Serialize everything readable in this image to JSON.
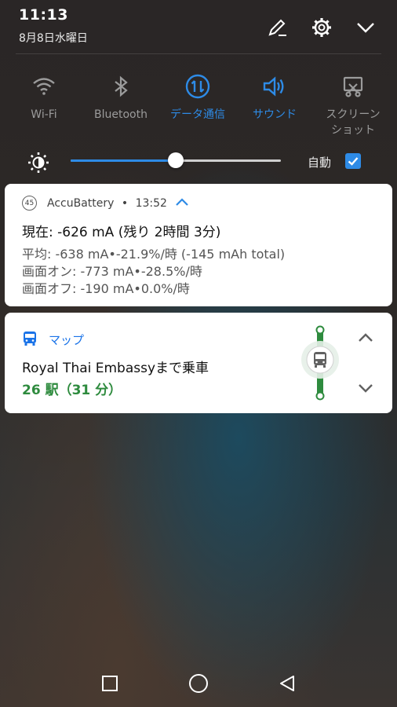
{
  "status": {
    "time": "11:13",
    "date": "8月8日水曜日"
  },
  "header_icons": [
    "edit-icon",
    "settings-icon",
    "collapse-chevron-icon"
  ],
  "toggles": [
    {
      "label": "Wi-Fi",
      "state": "off",
      "icon": "wifi-icon"
    },
    {
      "label": "Bluetooth",
      "state": "off",
      "icon": "bluetooth-icon"
    },
    {
      "label": "データ通信",
      "state": "on",
      "icon": "mobile-data-icon"
    },
    {
      "label": "サウンド",
      "state": "on",
      "icon": "sound-icon"
    },
    {
      "label": "スクリーン\nショット",
      "label_line1": "スクリーン",
      "label_line2": "ショット",
      "state": "off",
      "icon": "screenshot-icon"
    }
  ],
  "brightness": {
    "level": 0.5,
    "auto_label": "自動",
    "auto_checked": true
  },
  "notifications": {
    "battery": {
      "badge": "45",
      "app": "AccuBattery",
      "separator": "•",
      "time": "13:52",
      "title": "現在: -626 mA (残り 2時間 3分)",
      "lines": [
        "平均: -638 mA•-21.9%/時 (-145 mAh total)",
        "画面オン: -773 mA•-28.5%/時",
        "画面オフ: -190 mA•0.0%/時"
      ]
    },
    "maps": {
      "app": "マップ",
      "title": "Royal Thai Embassyまで乗車",
      "subtitle": "26 駅（31 分）"
    }
  },
  "colors": {
    "accent": "#2e8be6",
    "transit_green": "#2e8b3e"
  },
  "nav": [
    "recents-button",
    "home-button",
    "back-button"
  ]
}
